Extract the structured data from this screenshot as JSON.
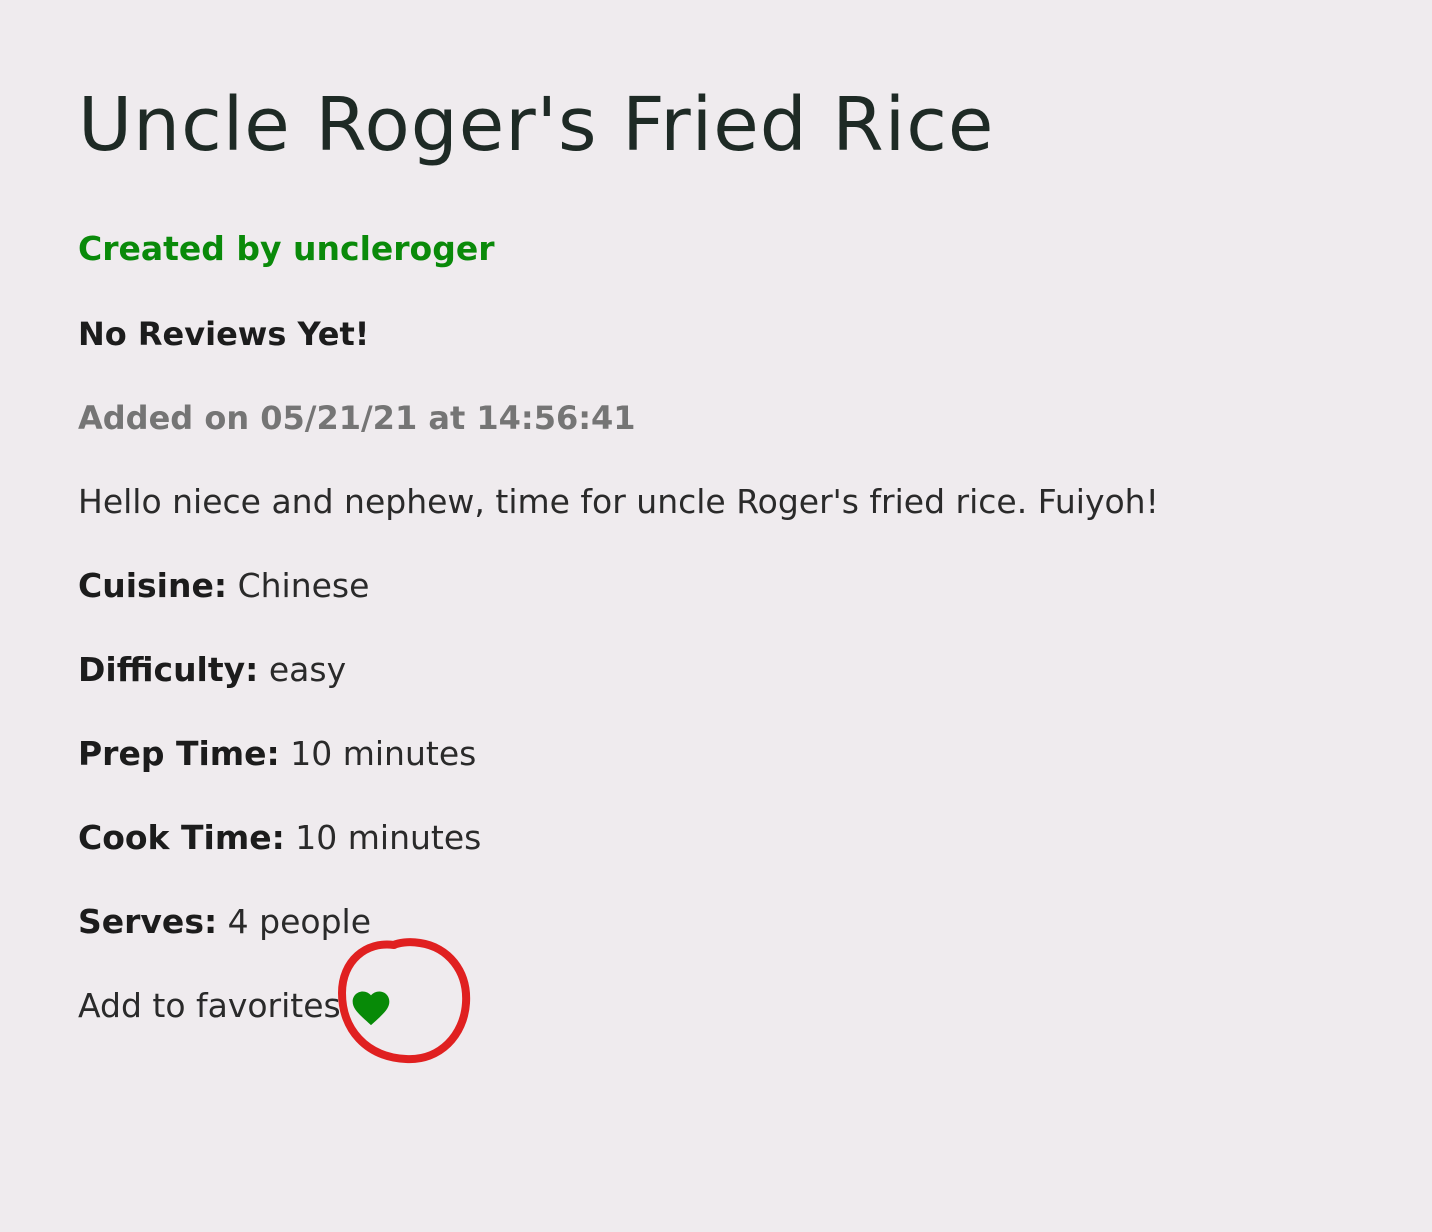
{
  "recipe": {
    "title": "Uncle Roger's Fried Rice",
    "author_text": "Created by uncleroger",
    "reviews_text": "No Reviews Yet!",
    "added_text": "Added on 05/21/21 at 14:56:41",
    "description": "Hello niece and nephew, time for uncle Roger's fried rice. Fuiyoh!",
    "cuisine": {
      "label": "Cuisine:",
      "value": "Chinese"
    },
    "difficulty": {
      "label": "Difficulty:",
      "value": "easy"
    },
    "prep_time": {
      "label": "Prep Time:",
      "value": "10 minutes"
    },
    "cook_time": {
      "label": "Cook Time:",
      "value": "10 minutes"
    },
    "serves": {
      "label": "Serves:",
      "value": "4 people"
    },
    "favorites": {
      "label": "Add to favorites",
      "icon": "heart-icon",
      "icon_color": "#078a07"
    }
  },
  "colors": {
    "background": "#efebee",
    "author": "#0a8a0a",
    "muted": "#757575",
    "annotation": "#e02020"
  },
  "annotation": {
    "shape": "hand-drawn-circle",
    "target": "favorite-heart-button"
  }
}
